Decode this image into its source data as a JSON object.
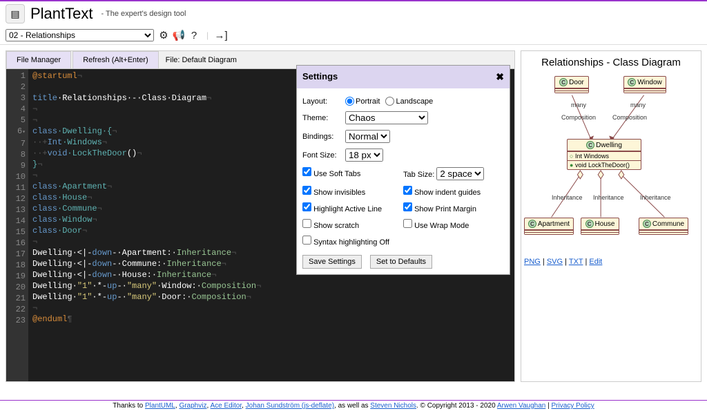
{
  "app": {
    "title": "PlantText",
    "tagline": "- The expert's design tool"
  },
  "toolbar": {
    "dropdown": "02 - Relationships"
  },
  "panel": {
    "fileManager": "File Manager",
    "refresh": "Refresh (Alt+Enter)",
    "fileLabel": "File: Default Diagram"
  },
  "code": {
    "l1_a": "@startuml",
    "l1_b": "¬",
    "l3_a": "title",
    "l3_b": "·Relationships·-·Class·Diagram",
    "l3_c": "¬",
    "l4": "¬",
    "l5": "¬",
    "l6_a": "class",
    "l6_b": "·Dwelling·{",
    "l6_c": "¬",
    "l7_a": "··+",
    "l7_b": "Int",
    "l7_c": "·Windows",
    "l7_d": "¬",
    "l8_a": "··+",
    "l8_b": "void",
    "l8_c": "·LockTheDoor",
    "l8_d": "()",
    "l8_e": "¬",
    "l9": "}",
    "l9_b": "¬",
    "l10": "¬",
    "l11_a": "class",
    "l11_b": "·Apartment",
    "l11_c": "¬",
    "l12_a": "class",
    "l12_b": "·House",
    "l12_c": "¬",
    "l13_a": "class",
    "l13_b": "·Commune",
    "l13_c": "¬",
    "l14_a": "class",
    "l14_b": "·Window",
    "l14_c": "¬",
    "l15_a": "class",
    "l15_b": "·Door",
    "l15_c": "¬",
    "l16": "¬",
    "l17_a": "Dwelling·<|-",
    "l17_b": "down",
    "l17_c": "-·Apartment:·",
    "l17_d": "Inheritance",
    "l17_e": "¬",
    "l18_a": "Dwelling·<|-",
    "l18_b": "down",
    "l18_c": "-·Commune:·",
    "l18_d": "Inheritance",
    "l18_e": "¬",
    "l19_a": "Dwelling·<|-",
    "l19_b": "down",
    "l19_c": "-·House:·",
    "l19_d": "Inheritance",
    "l19_e": "¬",
    "l20_a": "Dwelling·",
    "l20_b": "\"1\"",
    "l20_c": "·*-",
    "l20_d": "up",
    "l20_e": "-·",
    "l20_f": "\"many\"",
    "l20_g": "·Window:·",
    "l20_h": "Composition",
    "l20_i": "¬",
    "l21_a": "Dwelling·",
    "l21_b": "\"1\"",
    "l21_c": "·*-",
    "l21_d": "up",
    "l21_e": "-·",
    "l21_f": "\"many\"",
    "l21_g": "·Door:·",
    "l21_h": "Composition",
    "l21_i": "¬",
    "l22": "¬",
    "l23_a": "@enduml",
    "l23_b": "¶"
  },
  "settings": {
    "title": "Settings",
    "layout": "Layout:",
    "portrait": "Portrait",
    "landscape": "Landscape",
    "theme": "Theme:",
    "themeValue": "Chaos",
    "bindings": "Bindings:",
    "bindingsValue": "Normal",
    "fontSize": "Font Size:",
    "fontSizeValue": "18 px",
    "useSoftTabs": "Use Soft Tabs",
    "tabSize": "Tab Size:",
    "tabSizeValue": "2 space",
    "showInvisibles": "Show invisibles",
    "showIndentGuides": "Show indent guides",
    "highlightActiveLine": "Highlight Active Line",
    "showPrintMargin": "Show Print Margin",
    "showScratch": "Show scratch",
    "useWrapMode": "Use Wrap Mode",
    "syntaxOff": "Syntax highlighting Off",
    "save": "Save Settings",
    "defaults": "Set to Defaults"
  },
  "diagram": {
    "title": "Relationships - Class Diagram",
    "door": "Door",
    "window": "Window",
    "dwelling": "Dwelling",
    "intWindows": "Int Windows",
    "lockDoor": "void LockTheDoor()",
    "apartment": "Apartment",
    "house": "House",
    "commune": "Commune",
    "many1": "many",
    "many2": "many",
    "comp1": "Composition",
    "comp2": "Composition",
    "inh1": "Inheritance",
    "inh2": "Inheritance",
    "inh3": "Inheritance"
  },
  "links": {
    "png": "PNG",
    "svg": "SVG",
    "txt": "TXT",
    "edit": "Edit",
    "sep": " | "
  },
  "footer": {
    "t1": "Thanks to ",
    "plantuml": "PlantUML",
    "graphviz": "Graphviz",
    "ace": "Ace Editor",
    "johan": "Johan Sundström (js-deflate)",
    "t2": ", as well as ",
    "steven": "Steven Nichols",
    "t3": ". © Copyright 2013 - 2020 ",
    "arwen": "Arwen Vaughan",
    "sep": " | ",
    "privacy": "Privacy Policy",
    "comma": ", "
  }
}
